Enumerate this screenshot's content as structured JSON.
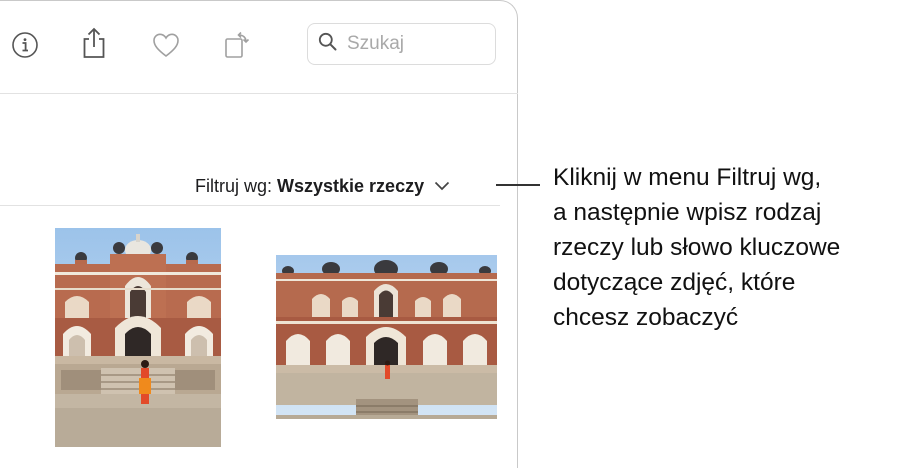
{
  "toolbar": {
    "info_icon": "info-circle-icon",
    "share_icon": "share-icon",
    "favorite_icon": "heart-icon",
    "rotate_icon": "rotate-icon",
    "search": {
      "placeholder": "Szukaj",
      "icon": "magnifying-glass-icon"
    }
  },
  "filter": {
    "prefix": "Filtruj wg:",
    "value": "Wszystkie rzeczy",
    "icon": "chevron-down-icon"
  },
  "photos": [
    {
      "subject": "Humayun's Tomb portrait photo"
    },
    {
      "subject": "Humayun's Tomb landscape photo"
    }
  ],
  "callout": {
    "lines": [
      "Kliknij w menu Filtruj wg,",
      "a następnie wpisz rodzaj",
      "rzeczy lub słowo kluczowe",
      "dotyczące zdjęć, które",
      "chcesz zobaczyć"
    ]
  }
}
